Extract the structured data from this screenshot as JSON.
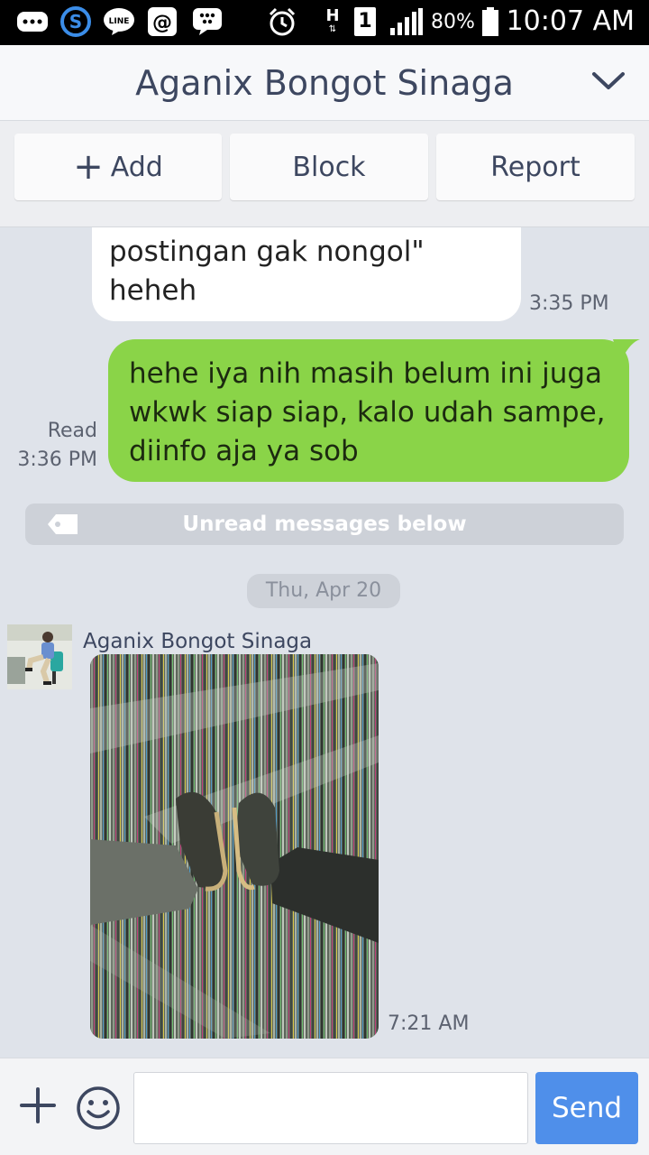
{
  "status_bar": {
    "battery_percent": "80%",
    "time": "10:07 AM",
    "network_h": "H",
    "sim_slot": "1",
    "app_icons": [
      "more-icon",
      "skype-icon",
      "line-icon",
      "email-at-icon",
      "bbm-icon"
    ],
    "system_icons": [
      "alarm-icon",
      "network-h-icon",
      "sim-1-icon",
      "signal-icon",
      "battery-icon"
    ]
  },
  "header": {
    "title": "Aganix Bongot Sinaga"
  },
  "actions": {
    "add_label": "Add",
    "add_glyph": "+",
    "block_label": "Block",
    "report_label": "Report"
  },
  "messages": {
    "incoming_1": {
      "text": "postingan gak nongol\" heheh",
      "time": "3:35 PM"
    },
    "outgoing_1": {
      "text": "hehe iya nih masih belum ini juga wkwk siap siap, kalo udah sampe, diinfo aja ya sob",
      "read_label": "Read",
      "time": "3:36 PM"
    },
    "unread_banner": "Unread messages below",
    "date_separator": "Thu, Apr 20",
    "incoming_2": {
      "sender": "Aganix Bongot Sinaga",
      "time": "7:21 AM"
    }
  },
  "input_bar": {
    "message_value": "",
    "send_label": "Send"
  },
  "colors": {
    "outgoing_bubble": "#8ad448",
    "incoming_bubble": "#ffffff",
    "chat_background": "#dfe3ea",
    "send_button": "#4f8fea",
    "title_text": "#3d4760"
  }
}
